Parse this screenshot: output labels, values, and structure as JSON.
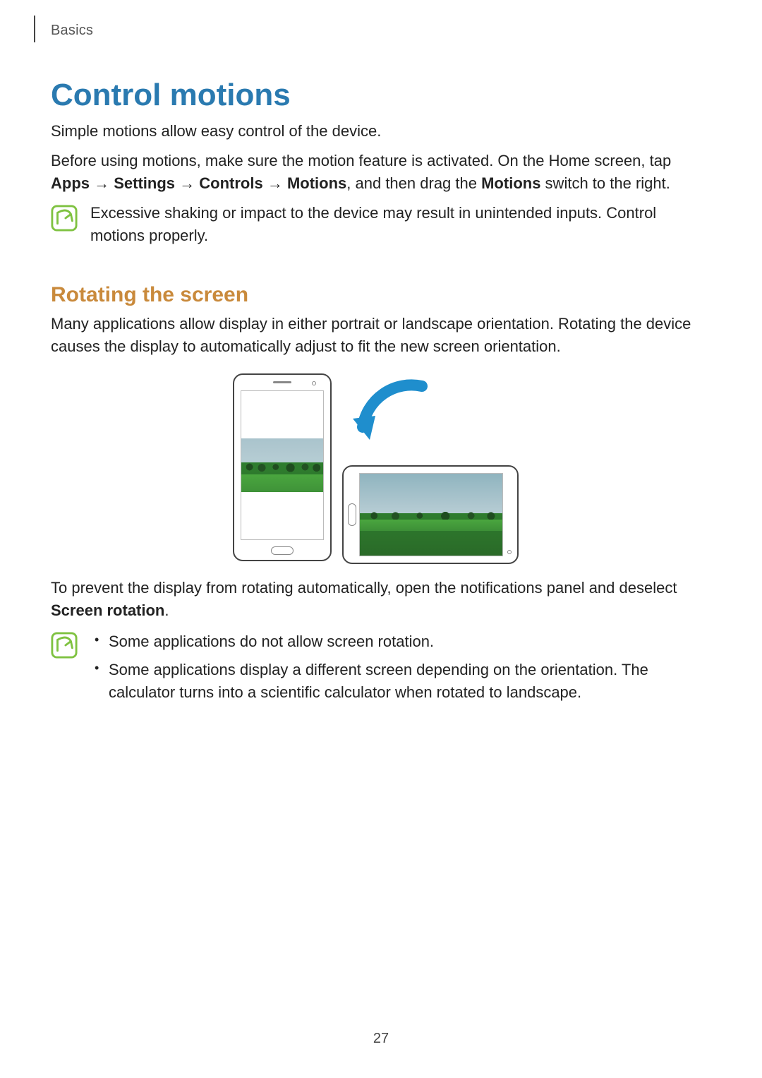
{
  "breadcrumb": "Basics",
  "headings": {
    "title": "Control motions",
    "rotate_sub": "Rotating the screen"
  },
  "intro": {
    "line1": "Simple motions allow easy control of the device.",
    "line2_pre": "Before using motions, make sure the motion feature is activated. On the Home screen, tap ",
    "path_apps": "Apps",
    "arrow": " → ",
    "path_settings": "Settings",
    "path_controls": "Controls",
    "path_motions": "Motions",
    "line2_mid": ", and then drag the ",
    "motions_bold": "Motions",
    "line2_end": " switch to the right."
  },
  "note1": {
    "text": "Excessive shaking or impact to the device may result in unintended inputs. Control motions properly."
  },
  "rotate": {
    "para": "Many applications allow display in either portrait or landscape orientation. Rotating the device causes the display to automatically adjust to fit the new screen orientation.",
    "prevent_pre": "To prevent the display from rotating automatically, open the notifications panel and deselect ",
    "prevent_bold": "Screen rotation",
    "prevent_end": "."
  },
  "note2": {
    "bullet1": "Some applications do not allow screen rotation.",
    "bullet2": "Some applications display a different screen depending on the orientation. The calculator turns into a scientific calculator when rotated to landscape."
  },
  "page_number": "27"
}
